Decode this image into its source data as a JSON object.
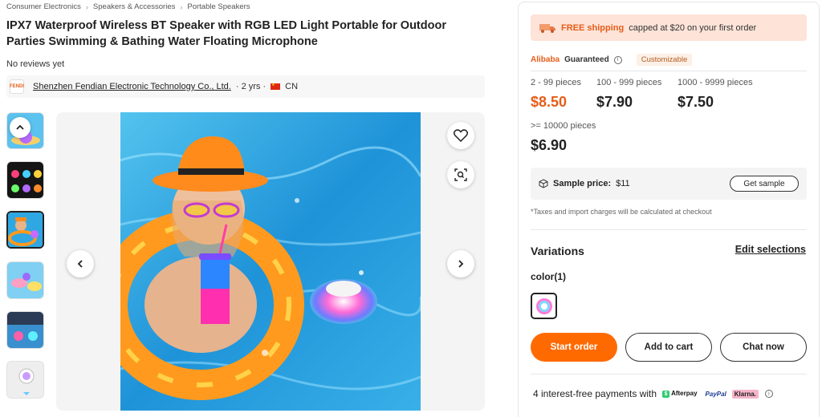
{
  "breadcrumb": [
    "Consumer Electronics",
    "Speakers & Accessories",
    "Portable Speakers"
  ],
  "breadcrumb_separator": "›",
  "title": "IPX7 Waterproof Wireless BT Speaker with RGB LED Light Portable for Outdoor Parties Swimming & Bathing Water Floating Microphone",
  "reviews": "No reviews yet",
  "supplier": {
    "logo_text": "FENDI",
    "name": "Shenzhen Fendian Electronic Technology Co., Ltd.",
    "years": "· 2 yrs ·",
    "country": "CN"
  },
  "shipping": {
    "highlight": "FREE shipping",
    "text": "capped at $20 on your first order"
  },
  "guarantee": {
    "brand": "Alibaba",
    "label": "Guaranteed",
    "tag": "Customizable"
  },
  "tiers": [
    {
      "range": "2 - 99 pieces",
      "price": "$8.50"
    },
    {
      "range": "100 - 999 pieces",
      "price": "$7.90"
    },
    {
      "range": "1000 - 9999 pieces",
      "price": "$7.50"
    },
    {
      "range": ">= 10000 pieces",
      "price": "$6.90"
    }
  ],
  "sample": {
    "label": "Sample price:",
    "value": "$11",
    "button": "Get sample"
  },
  "tax_note": "*Taxes and import charges will be calculated at checkout",
  "variations": {
    "title": "Variations",
    "edit": "Edit selections",
    "color_label": "color(1)"
  },
  "actions": {
    "start_order": "Start order",
    "add_to_cart": "Add to cart",
    "chat_now": "Chat now"
  },
  "payment": {
    "text": "4 interest-free payments with",
    "providers": [
      "Afterpay",
      "PayPal",
      "Klarna."
    ]
  },
  "colors": {
    "accent": "#ff6a00",
    "ship_bg": "#fde3d8"
  },
  "icons": [
    "chevron-up-icon",
    "chevron-left-icon",
    "chevron-right-icon",
    "heart-icon",
    "image-search-icon",
    "info-icon",
    "cube-icon",
    "truck-icon"
  ]
}
